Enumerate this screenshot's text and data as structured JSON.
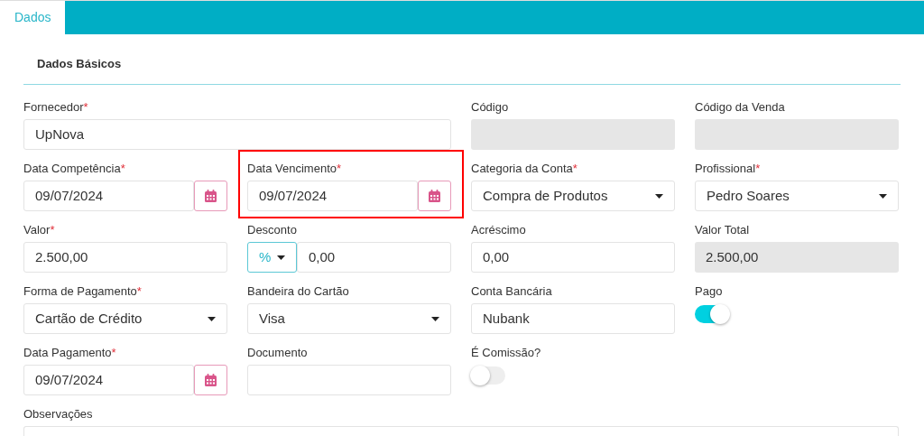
{
  "tabs": [
    {
      "label": "Dados",
      "selected": true
    }
  ],
  "section": {
    "title": "Dados Básicos"
  },
  "fields": [
    {
      "kind": "text",
      "label": "Fornecedor",
      "mark": "*",
      "value": "UpNova",
      "wide": true
    },
    {
      "kind": "disabled",
      "label": "Código"
    },
    {
      "kind": "disabled",
      "label": "Código da Venda"
    },
    {
      "kind": "date",
      "label": "Data Competência",
      "mark": "*",
      "value": "09/07/2024"
    },
    {
      "kind": "date",
      "label": "Data Vencimento",
      "mark": "*",
      "value": "09/07/2024",
      "highlighted": true
    },
    {
      "kind": "select",
      "label": "Categoria da Conta",
      "mark": "*",
      "value": "Compra de Produtos"
    },
    {
      "kind": "select",
      "label": "Profissional",
      "mark": "*",
      "value": "Pedro Soares"
    },
    {
      "kind": "text",
      "label": "Valor",
      "mark": "*",
      "value": "2.500,00"
    },
    {
      "kind": "discount",
      "label": "Desconto",
      "unit": "%",
      "value": "0,00"
    },
    {
      "kind": "text",
      "label": "Acréscimo",
      "value": "0,00"
    },
    {
      "kind": "disabled",
      "label": "Valor Total",
      "value": "2.500,00"
    },
    {
      "kind": "select",
      "label": "Forma de Pagamento",
      "mark": "*",
      "value": "Cartão de Crédito"
    },
    {
      "kind": "select",
      "label": "Bandeira do Cartão",
      "value": "Visa"
    },
    {
      "kind": "text",
      "label": "Conta Bancária",
      "value": "Nubank"
    },
    {
      "kind": "toggle",
      "label": "Pago",
      "on": true
    },
    {
      "kind": "date",
      "label": "Data Pagamento",
      "mark": "*",
      "value": "09/07/2024"
    },
    {
      "kind": "text",
      "label": "Documento"
    },
    {
      "kind": "toggle",
      "label": "É Comissão?",
      "on": false
    },
    {
      "kind": "spacer"
    },
    {
      "kind": "textarea",
      "label": "Observações",
      "full": true
    }
  ]
}
